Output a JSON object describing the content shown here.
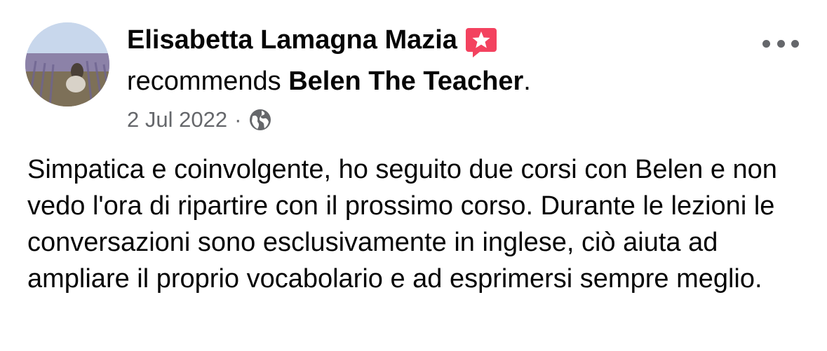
{
  "post": {
    "author_name": "Elisabetta Lamagna Mazia",
    "action_text": "recommends",
    "page_name": "Belen The Teacher",
    "action_suffix": ".",
    "date": "2 Jul 2022",
    "separator": "·",
    "privacy_icon": "globe-icon",
    "badge_icon": "recommendation-star-icon",
    "more_icon": "more-options-icon",
    "review_text": "Simpatica e coinvolgente, ho seguito due corsi con Belen e non vedo l'ora di ripartire con il prossimo corso. Durante le lezioni le conversazioni sono esclusivamente in inglese, ciò aiuta ad ampliare il proprio vocabolario e ad esprimersi sempre meglio."
  },
  "colors": {
    "badge": "#f3425f",
    "secondary_text": "#65676b",
    "primary_text": "#050505"
  }
}
